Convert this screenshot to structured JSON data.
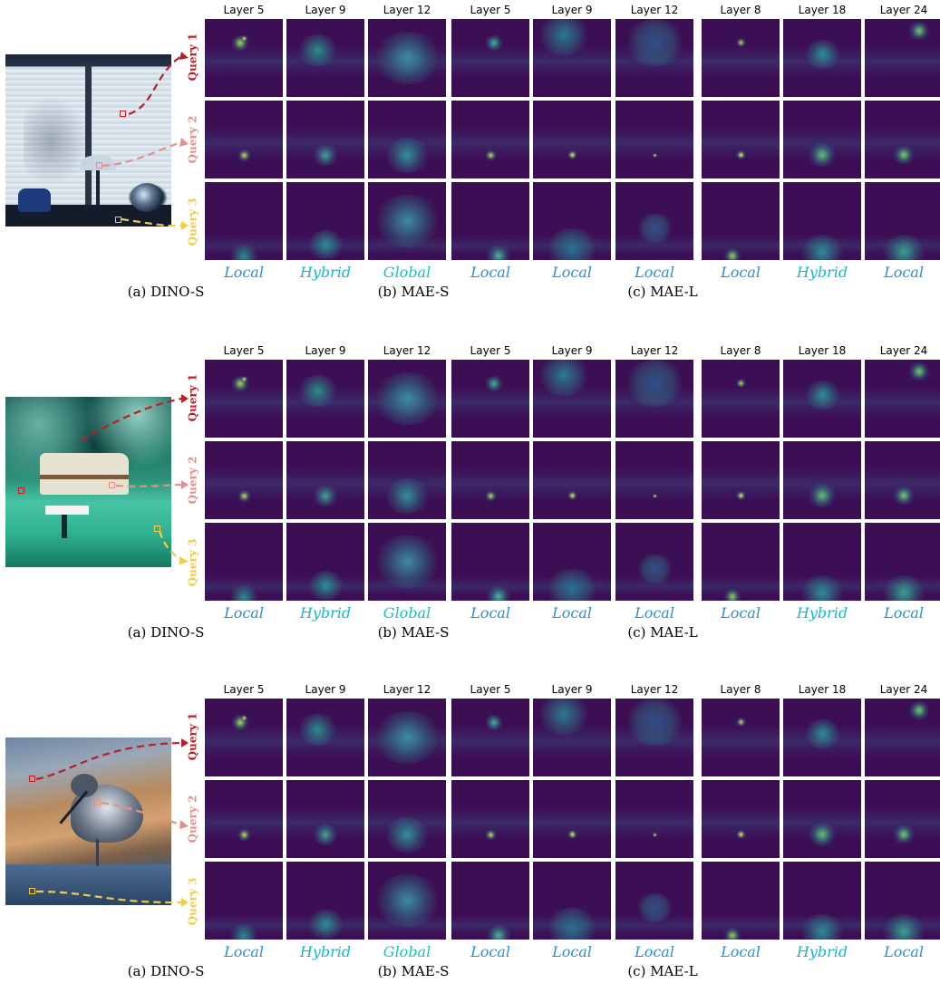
{
  "figures": [
    {
      "photo": "lamp-window-photo",
      "layers": [
        "Layer 5",
        "Layer 9",
        "Layer 12",
        "Layer 5",
        "Layer 9",
        "Layer 12",
        "Layer 8",
        "Layer 18",
        "Layer 24"
      ],
      "queries": [
        "Query 1",
        "Query 2",
        "Query 3"
      ],
      "modes": [
        "Local",
        "Hybrid",
        "Global",
        "Local",
        "Local",
        "Local",
        "Local",
        "Hybrid",
        "Local"
      ],
      "captions": [
        "(a)  DINO-S",
        "(b)  MAE-S",
        "(c)  MAE-L"
      ]
    },
    {
      "photo": "rv-campsite-photo",
      "layers": [
        "Layer 5",
        "Layer 9",
        "Layer 12",
        "Layer 5",
        "Layer 9",
        "Layer 12",
        "Layer 8",
        "Layer 18",
        "Layer 24"
      ],
      "queries": [
        "Query 1",
        "Query 2",
        "Query 3"
      ],
      "modes": [
        "Local",
        "Hybrid",
        "Global",
        "Local",
        "Local",
        "Local",
        "Local",
        "Hybrid",
        "Local"
      ],
      "captions": [
        "(a)  DINO-S",
        "(b)  MAE-S",
        "(c)  MAE-L"
      ]
    },
    {
      "photo": "bird-water-photo",
      "layers": [
        "Layer 5",
        "Layer 9",
        "Layer 12",
        "Layer 5",
        "Layer 9",
        "Layer 12",
        "Layer 8",
        "Layer 18",
        "Layer 24"
      ],
      "queries": [
        "Query 1",
        "Query 2",
        "Query 3"
      ],
      "modes": [
        "Local",
        "Hybrid",
        "Global",
        "Local",
        "Local",
        "Local",
        "Local",
        "Hybrid",
        "Local"
      ],
      "captions": [
        "(a)  DINO-S",
        "(b)  MAE-S",
        "(c)  MAE-L"
      ]
    }
  ],
  "colors": {
    "query1": "#b81f28",
    "query2": "#e1908c",
    "query3": "#f0cc4a",
    "attention_low": "#3c0f55",
    "attention_mid": "#2a8c8c",
    "attention_high": "#f3e94a",
    "mode_local": "#2a8fd0",
    "mode_hybrid": "#1ab3c9",
    "mode_global": "#1bbfb5"
  }
}
